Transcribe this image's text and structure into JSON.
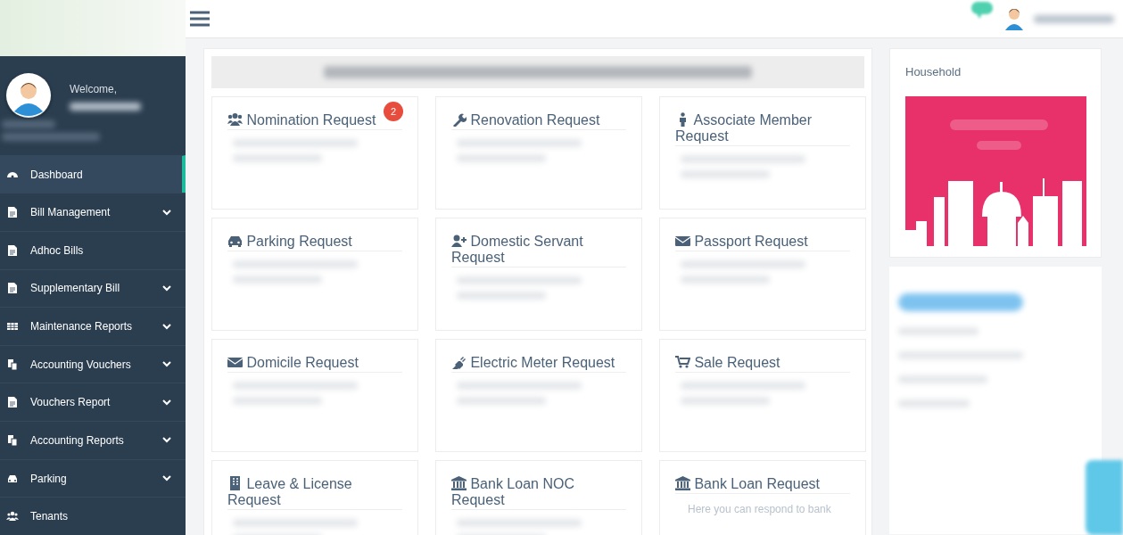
{
  "sidebar": {
    "welcome": "Welcome,",
    "items": [
      {
        "label": "Dashboard",
        "selected": true,
        "submenu": false
      },
      {
        "label": "Bill Management",
        "selected": false,
        "submenu": true
      },
      {
        "label": "Adhoc Bills",
        "selected": false,
        "submenu": false
      },
      {
        "label": "Supplementary Bill",
        "selected": false,
        "submenu": true
      },
      {
        "label": "Maintenance Reports",
        "selected": false,
        "submenu": true
      },
      {
        "label": "Accounting Vouchers",
        "selected": false,
        "submenu": true
      },
      {
        "label": "Vouchers Report",
        "selected": false,
        "submenu": true
      },
      {
        "label": "Accounting Reports",
        "selected": false,
        "submenu": true
      },
      {
        "label": "Parking",
        "selected": false,
        "submenu": true
      },
      {
        "label": "Tenants",
        "selected": false,
        "submenu": false
      }
    ]
  },
  "requests": [
    {
      "title": "Nomination Request",
      "badge": "2"
    },
    {
      "title": "Renovation Request"
    },
    {
      "title": "Associate Member Request"
    },
    {
      "title": "Parking Request"
    },
    {
      "title": "Domestic Servant Request"
    },
    {
      "title": "Passport Request"
    },
    {
      "title": "Domicile Request"
    },
    {
      "title": "Electric Meter Request"
    },
    {
      "title": "Sale Request"
    },
    {
      "title": "Leave & License Request"
    },
    {
      "title": "Bank Loan NOC Request"
    },
    {
      "title": "Bank Loan Request",
      "description": "Here you can respond to bank"
    }
  ],
  "household": {
    "title": "Household"
  }
}
